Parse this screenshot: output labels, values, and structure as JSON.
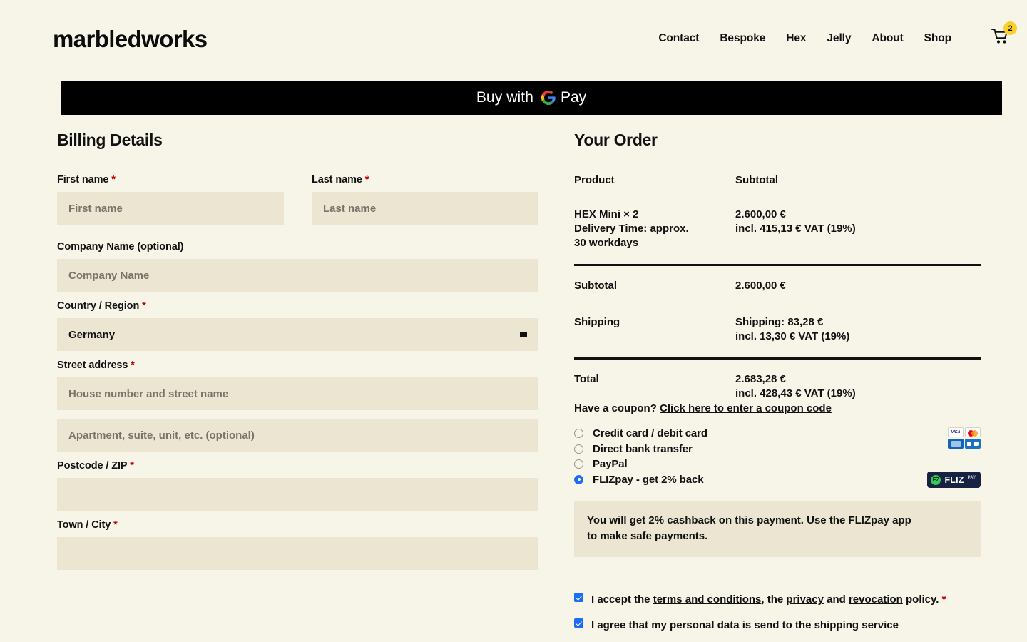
{
  "header": {
    "brand": "marbledworks",
    "nav": [
      {
        "label": "Contact",
        "name": "nav-contact"
      },
      {
        "label": "Bespoke",
        "name": "nav-bespoke"
      },
      {
        "label": "Hex",
        "name": "nav-hex"
      },
      {
        "label": "Jelly",
        "name": "nav-jelly"
      },
      {
        "label": "About",
        "name": "nav-about"
      },
      {
        "label": "Shop",
        "name": "nav-shop"
      }
    ],
    "cart_count": "2",
    "cart_badge_color": "#fbd02c"
  },
  "express_pay": {
    "label": "Buy with",
    "wordmark": "Pay",
    "background": "#000000"
  },
  "billing": {
    "title": "Billing Details",
    "first_name": {
      "label": "First name",
      "required": true,
      "placeholder": "First name",
      "value": ""
    },
    "last_name": {
      "label": "Last name",
      "required": true,
      "placeholder": "Last name",
      "value": ""
    },
    "company": {
      "label": "Company Name (optional)",
      "required": false,
      "placeholder": "Company Name",
      "value": ""
    },
    "country": {
      "label": "Country / Region",
      "required": true,
      "value": "Germany"
    },
    "street": {
      "label": "Street address",
      "required": true,
      "placeholder": "House number and street name",
      "value": ""
    },
    "street2": {
      "placeholder": "Apartment, suite, unit, etc. (optional)",
      "value": ""
    },
    "postcode": {
      "label": "Postcode / ZIP",
      "required": true,
      "placeholder": "",
      "value": ""
    },
    "city": {
      "label": "Town / City",
      "required": true,
      "placeholder": "",
      "value": ""
    }
  },
  "order": {
    "title": "Your Order",
    "col_product": "Product",
    "col_subtotal": "Subtotal",
    "line_item": {
      "name": "HEX Mini  × 2",
      "delivery_line1": "Delivery Time: approx.",
      "delivery_line2": "30 workdays",
      "price": "2.600,00 €",
      "vat": "incl. 415,13 € VAT (19%)"
    },
    "subtotal": {
      "label": "Subtotal",
      "value": "2.600,00 €"
    },
    "shipping": {
      "label": "Shipping",
      "value": "Shipping: 83,28 €",
      "vat": "incl. 13,30 € VAT (19%)"
    },
    "total": {
      "label": "Total",
      "value": "2.683,28 €",
      "vat": "incl. 428,43 € VAT (19%)"
    },
    "coupon_prefix": "Have a coupon?",
    "coupon_link": "Click here to enter a coupon code"
  },
  "payment": {
    "methods": [
      {
        "label": "Credit card / debit card",
        "selected": false
      },
      {
        "label": "Direct bank transfer",
        "selected": false
      },
      {
        "label": "PayPal",
        "selected": false
      },
      {
        "label": "FLIZpay - get 2% back",
        "selected": true
      }
    ],
    "cards": [
      "VISA",
      "mastercard",
      "ec-card",
      "debit-card"
    ],
    "fliz_logo": {
      "mark": "FZ",
      "name": "FLIZ",
      "sub": "PAY",
      "bg": "#172243",
      "accent": "#34c759"
    },
    "notice_line1": "You will get 2% cashback on this payment. Use the FLIZpay app",
    "notice_line2": "to make safe payments."
  },
  "terms": {
    "accept_prefix": "I accept the ",
    "link_terms": "terms and conditions",
    "accept_mid": ", the ",
    "link_privacy": "privacy",
    "accept_and": " and ",
    "link_revocation": "revocation",
    "accept_suffix": "policy.",
    "shipping_consent": "I agree that my personal data is send to the shipping service",
    "checked": true
  }
}
